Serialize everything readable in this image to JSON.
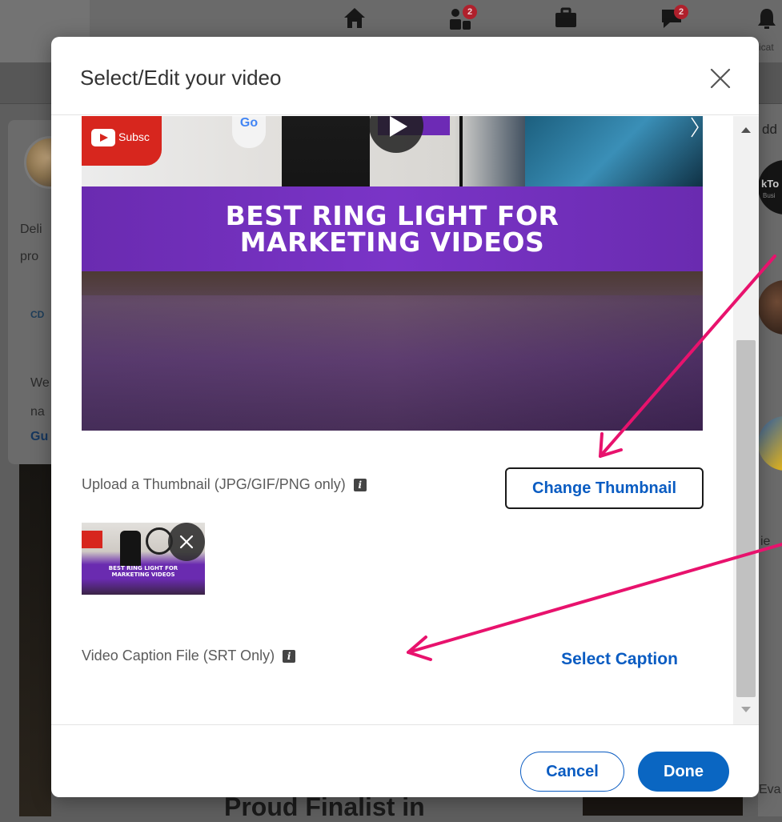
{
  "modal": {
    "title": "Select/Edit your video",
    "thumbnail_label": "Upload a Thumbnail (JPG/GIF/PNG only)",
    "change_thumbnail_label": "Change Thumbnail",
    "caption_label": "Video Caption File (SRT Only)",
    "select_caption_label": "Select Caption",
    "cancel_label": "Cancel",
    "done_label": "Done",
    "info_glyph": "i",
    "close_icon": "close-icon"
  },
  "video_preview": {
    "banner_line1": "BEST RING LIGHT FOR",
    "banner_line2": "MARKETING VIDEOS",
    "pillow_text": "Subsc",
    "sign_text": "Go"
  },
  "thumbnail": {
    "text_line1": "BEST RING LIGHT FOR",
    "text_line2": "MARKETING VIDEOS"
  },
  "background": {
    "nav": [
      {
        "icon": "home-icon"
      },
      {
        "icon": "people-icon",
        "badge": "2"
      },
      {
        "icon": "briefcase-icon"
      },
      {
        "icon": "messaging-icon",
        "badge": "2"
      },
      {
        "icon": "bell-icon"
      }
    ],
    "nav_label_partial": "icat",
    "left_text_1": "Deli",
    "left_text_2": "pro",
    "left_text_3": "CD",
    "left_text_4": "We",
    "left_text_5": "na",
    "left_link": "Gu",
    "right_heading_partial": "dd",
    "right_logo_partial": "kTo",
    "right_logo_sub": "Busi",
    "right_text_partial": "ie",
    "right_bottom_partial": "Eva",
    "bottom_banner": "Proud Finalist in"
  },
  "colors": {
    "accent_blue": "#0a66c2",
    "annotation_pink": "#e8126d",
    "overlay": "#5e5e5e"
  }
}
